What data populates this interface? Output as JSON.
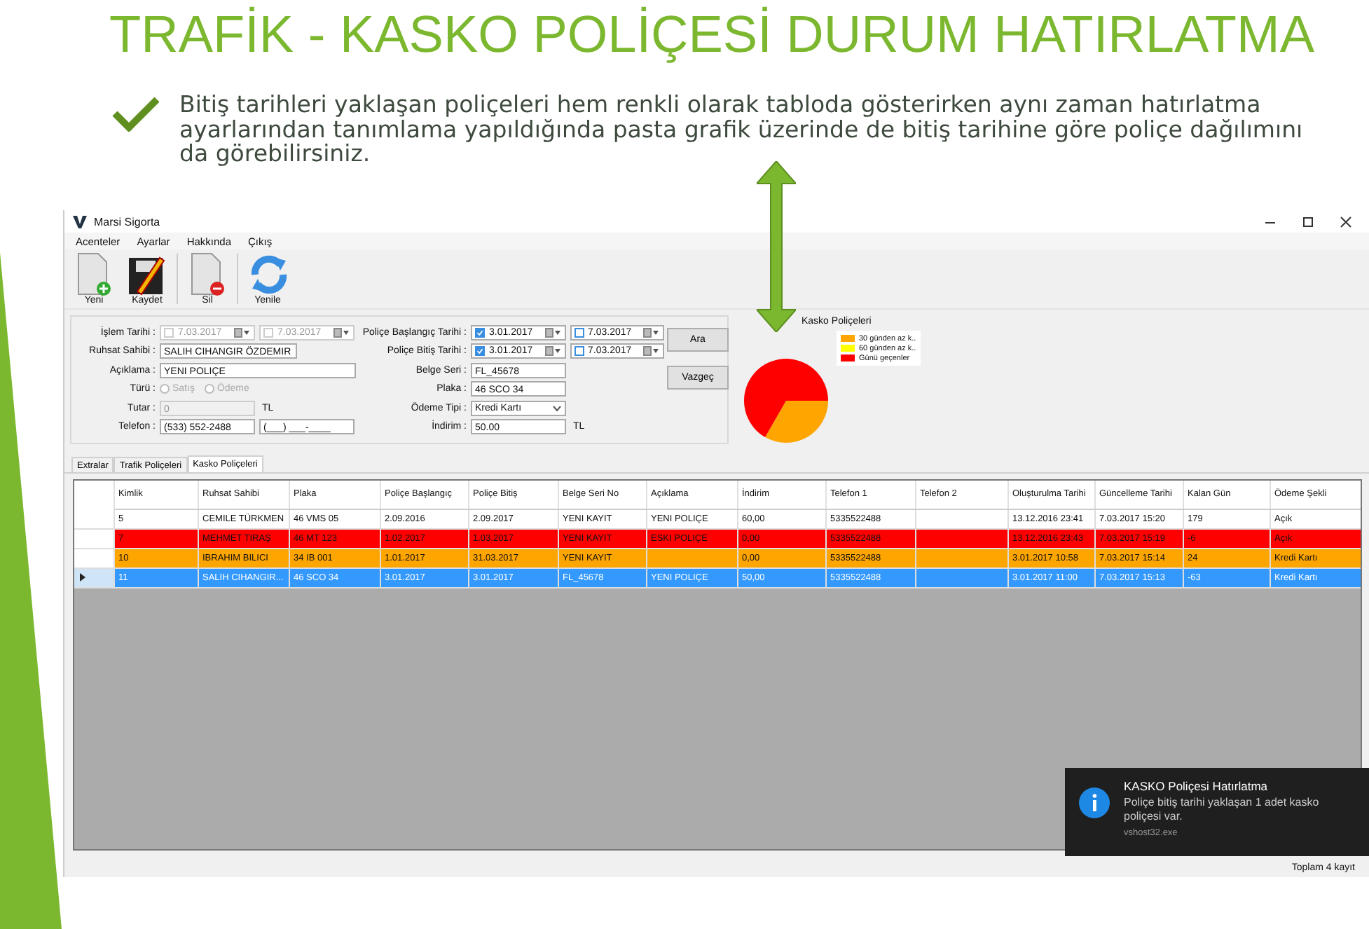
{
  "slide": {
    "title": "TRAFİK - KASKO POLİÇESİ DURUM HATIRLATMA",
    "bullet": "Bitiş tarihleri yaklaşan poliçeleri hem renkli olarak tabloda gösterirken aynı zaman hatırlatma ayarlarından tanımlama yapıldığında pasta grafik üzerinde de bitiş tarihine göre poliçe dağılımını da görebilirsiniz."
  },
  "window": {
    "title": "Marsi Sigorta"
  },
  "menu": [
    "Acenteler",
    "Ayarlar",
    "Hakkında",
    "Çıkış"
  ],
  "toolbar": [
    {
      "kind": "new",
      "label": "Yeni"
    },
    {
      "kind": "save",
      "label": "Kaydet"
    },
    {
      "kind": "delete",
      "label": "Sil"
    },
    {
      "kind": "refresh",
      "label": "Yenile"
    }
  ],
  "form_left": [
    {
      "kind": "dates",
      "label": "İşlem Tarihi :",
      "dates": [
        {
          "value": "7.03.2017",
          "checked": false,
          "disabled": true
        },
        {
          "value": "7.03.2017",
          "checked": false,
          "disabled": true
        }
      ]
    },
    {
      "kind": "text",
      "label": "Ruhsat Sahibi :",
      "value": "SALIH CIHANGIR ÖZDEMIR"
    },
    {
      "kind": "text",
      "label": "Açıklama :",
      "value": "YENI POLIÇE"
    },
    {
      "kind": "radios",
      "label": "Türü :",
      "options": [
        {
          "label": "Satış",
          "selected": false,
          "disabled": true
        },
        {
          "label": "Ödeme",
          "selected": false,
          "disabled": true
        }
      ]
    },
    {
      "kind": "text",
      "label": "Tutar :",
      "value": "0",
      "disabled": true,
      "unit": "TL"
    },
    {
      "kind": "pair",
      "label": "Telefon :",
      "values": [
        "(533) 552-2488",
        "(___) ___-____"
      ]
    }
  ],
  "form_right": [
    {
      "kind": "dates",
      "label": "Poliçe Başlangıç Tarihi :",
      "dates": [
        {
          "value": "3.01.2017",
          "checked": true,
          "disabled": false
        },
        {
          "value": "7.03.2017",
          "checked": false,
          "disabled": false
        }
      ]
    },
    {
      "kind": "dates",
      "label": "Poliçe Bitiş Tarihi :",
      "dates": [
        {
          "value": "3.01.2017",
          "checked": true,
          "disabled": false
        },
        {
          "value": "7.03.2017",
          "checked": false,
          "disabled": false
        }
      ]
    },
    {
      "kind": "text",
      "label": "Belge Seri :",
      "value": "FL_45678"
    },
    {
      "kind": "text",
      "label": "Plaka :",
      "value": "46 SCO 34"
    },
    {
      "kind": "select",
      "label": "Ödeme Tipi :",
      "value": "Kredi Kartı"
    },
    {
      "kind": "text",
      "label": "İndirim :",
      "value": "50.00",
      "unit": "TL"
    }
  ],
  "form_buttons": [
    "Ara",
    "Vazgeç"
  ],
  "chart": {
    "title": "Kasko Poliçeleri",
    "chart_data": {
      "type": "pie",
      "categories": [
        "30 günden az k..",
        "60 günden az k..",
        "Günü geçenler"
      ],
      "series": [
        {
          "values": [
            33.3,
            0,
            66.7
          ]
        }
      ],
      "legend": true,
      "colors": [
        "#ffa500",
        "#ffff00",
        "#ff0000"
      ]
    }
  },
  "tabs": [
    {
      "label": "Extralar",
      "selected": false
    },
    {
      "label": "Trafik Poliçeleri",
      "selected": false
    },
    {
      "label": "Kasko Poliçeleri",
      "selected": true
    }
  ],
  "table": {
    "columns": [
      "Kimlik",
      "Ruhsat Sahibi",
      "Plaka",
      "Poliçe Başlangıç",
      "Poliçe Bitiş",
      "Belge Seri No",
      "Açıklama",
      "İndirim",
      "Telefon 1",
      "Telefon 2",
      "Oluşturulma Tarihi",
      "Güncelleme Tarihi",
      "Kalan Gün",
      "Ödeme Şekli"
    ],
    "rows": [
      {
        "selected": false,
        "color": "#ffffff",
        "cells": [
          "5",
          "CEMILE TÜRKMEN",
          "46 VMS 05",
          "2.09.2016",
          "2.09.2017",
          "YENI KAYIT",
          "YENI POLIÇE",
          "60,00",
          "5335522488",
          null,
          "13.12.2016 23:41",
          "7.03.2017 15:20",
          "179",
          "Açık"
        ]
      },
      {
        "selected": false,
        "color": "#ff0000",
        "cells": [
          "7",
          "MEHMET TIRAŞ",
          "46 MT 123",
          "1.02.2017",
          "1.03.2017",
          "YENI KAYIT",
          "ESKI POLIÇE",
          "0,00",
          "5335522488",
          null,
          "13.12.2016 23:43",
          "7.03.2017 15:19",
          "-6",
          "Açık"
        ]
      },
      {
        "selected": false,
        "color": "#ffa500",
        "cells": [
          "10",
          "IBRAHIM BILICI",
          "34 IB 001",
          "1.01.2017",
          "31.03.2017",
          "YENI KAYIT",
          null,
          "0,00",
          "5335522488",
          null,
          "3.01.2017 10:58",
          "7.03.2017 15:14",
          "24",
          "Kredi Kartı"
        ]
      },
      {
        "selected": true,
        "color": "#3399ff",
        "cells": [
          "11",
          "SALIH CIHANGIR...",
          "46 SCO 34",
          "3.01.2017",
          "3.01.2017",
          "FL_45678",
          "YENI POLIÇE",
          "50,00",
          "5335522488",
          null,
          "3.01.2017 11:00",
          "7.03.2017 15:13",
          "-63",
          "Kredi Kartı"
        ]
      }
    ]
  },
  "status_bar": "Toplam 4 kayıt",
  "notification": {
    "title": "KASKO Poliçesi Hatırlatma",
    "message": "Poliçe bitiş tarihi yaklaşan 1 adet kasko poliçesi var.",
    "source": "vshost32.exe"
  }
}
